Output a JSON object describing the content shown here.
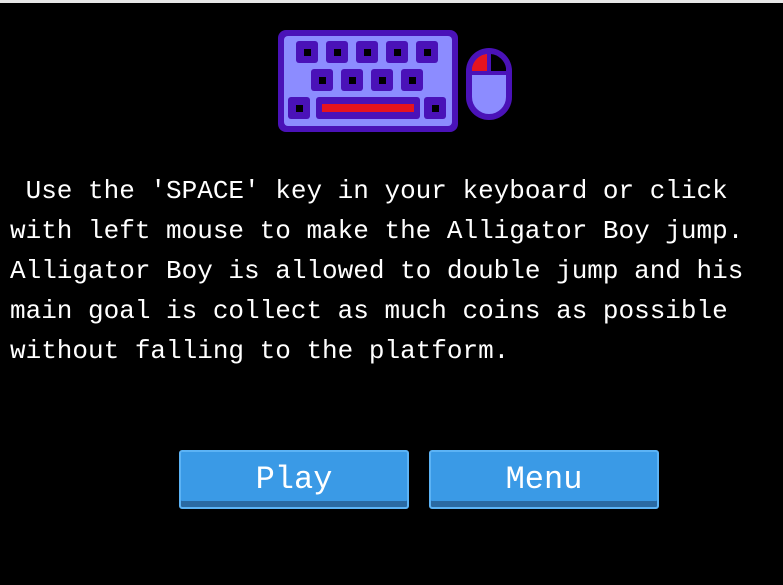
{
  "instructions": {
    "lines": [
      " Use the 'SPACE' key in your keyboard or click",
      "with left mouse to make the Alligator Boy jump.",
      "Alligator Boy is allowed to double jump and his",
      "main goal is collect as much coins as possible",
      "without falling to the platform."
    ]
  },
  "buttons": {
    "play_label": "Play",
    "menu_label": "Menu"
  },
  "illustration": {
    "icons": [
      "keyboard-icon",
      "mouse-icon"
    ]
  },
  "colors": {
    "background": "#000000",
    "button_fill": "#3a9ae6",
    "keyboard_body": "#8c8cff",
    "keyboard_outline": "#4a12b8",
    "space_bar": "#e6141e"
  }
}
